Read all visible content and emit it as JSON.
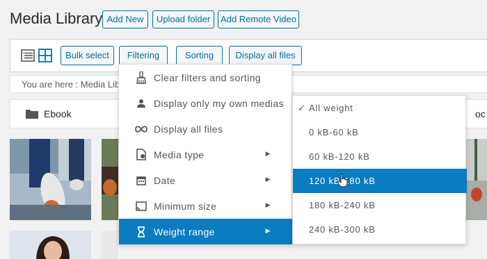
{
  "header": {
    "title": "Media Library",
    "add_new": "Add New",
    "upload_folder": "Upload folder",
    "add_remote_video": "Add Remote Video"
  },
  "toolbar": {
    "bulk_select": "Bulk select",
    "filtering": "Filtering",
    "sorting": "Sorting",
    "display_all_files": "Display all files"
  },
  "breadcrumb": {
    "text": "You are here :  Media Libr"
  },
  "folders": {
    "first": "Ebook",
    "partial_right": "oc"
  },
  "filter_menu": {
    "items": [
      {
        "label": "Clear filters and sorting",
        "icon": "broom-icon"
      },
      {
        "label": "Display only my own medias",
        "icon": "user-icon"
      },
      {
        "label": "Display all files",
        "icon": "infinity-icon"
      },
      {
        "label": "Media type",
        "icon": "file-type-icon",
        "submenu": true
      },
      {
        "label": "Date",
        "icon": "calendar-icon",
        "submenu": true
      },
      {
        "label": "Minimum size",
        "icon": "image-size-icon",
        "submenu": true
      },
      {
        "label": "Weight range",
        "icon": "hourglass-icon",
        "submenu": true,
        "active": true
      }
    ]
  },
  "weight_menu": {
    "items": [
      {
        "label": "All weight",
        "checked": true
      },
      {
        "label": "0 kB-60 kB"
      },
      {
        "label": "60 kB-120 kB"
      },
      {
        "label": "120 kB-180 kB",
        "active": true
      },
      {
        "label": "180 kB-240 kB"
      },
      {
        "label": "240 kB-300 kB"
      }
    ]
  },
  "colors": {
    "accent": "#0071a1",
    "menu_active": "#0a7cbf",
    "background": "#f1f1f1"
  }
}
